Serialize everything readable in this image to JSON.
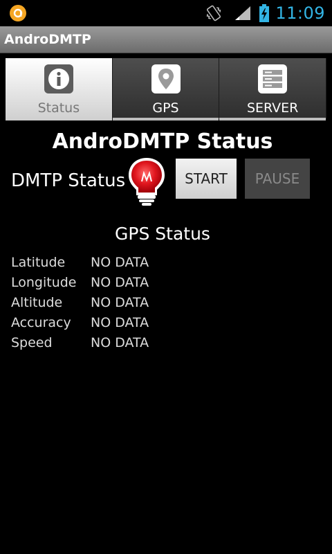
{
  "status_bar": {
    "clock": "11:09",
    "icons": [
      "app-notification-icon",
      "vibrate-icon",
      "signal-icon",
      "battery-charging-icon"
    ]
  },
  "app": {
    "title": "AndroDMTP"
  },
  "tabs": [
    {
      "label": "Status",
      "icon": "info-icon",
      "active": true
    },
    {
      "label": "GPS",
      "icon": "map-pin-icon",
      "active": false
    },
    {
      "label": "SERVER",
      "icon": "server-icon",
      "active": false
    }
  ],
  "main": {
    "heading": "AndroDMTP Status",
    "dmtp_label": "DMTP Status",
    "status_indicator": {
      "icon": "lightbulb-icon",
      "color": "#e0161e"
    },
    "start_label": "START",
    "pause_label": "PAUSE"
  },
  "gps": {
    "heading": "GPS Status",
    "rows": [
      {
        "label": "Latitude",
        "value": "NO DATA"
      },
      {
        "label": "Longitude",
        "value": "NO DATA"
      },
      {
        "label": "Altitude",
        "value": "NO DATA"
      },
      {
        "label": "Accuracy",
        "value": "NO DATA"
      },
      {
        "label": "Speed",
        "value": "NO DATA"
      }
    ]
  },
  "colors": {
    "background": "#000000",
    "clock": "#33b5e5",
    "accent_orange": "#f5a623"
  }
}
